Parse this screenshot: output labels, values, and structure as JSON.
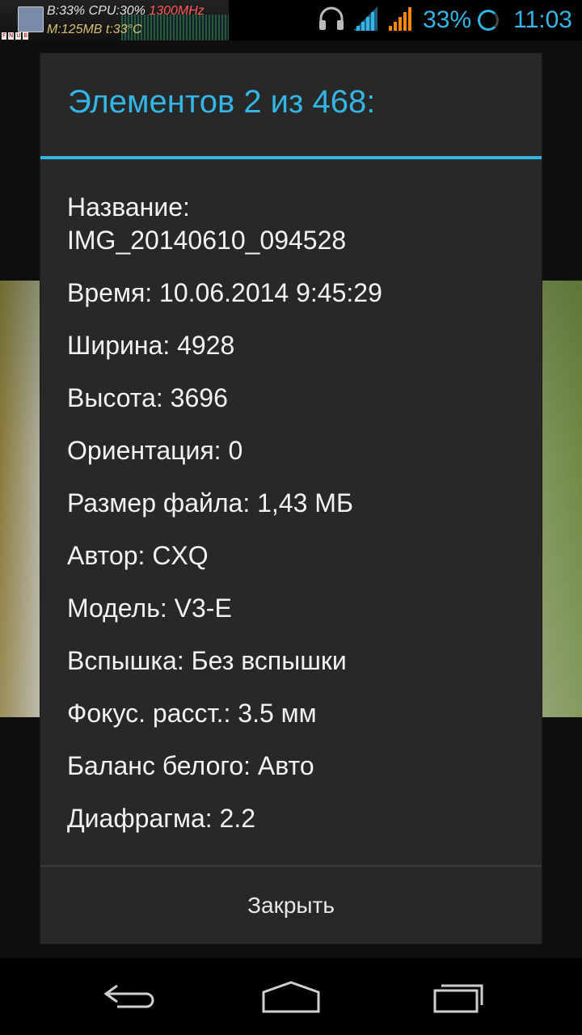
{
  "status_bar": {
    "monitor_line1_prefix": "B:33% CPU:30%",
    "monitor_freq": "1300MHz",
    "monitor_line2": "M:125MB t:33°C",
    "monitor_flags": [
      "F",
      "N",
      "U",
      "B"
    ],
    "battery_percent": "33%",
    "time": "11:03",
    "icons": [
      "headphones-icon",
      "wifi-signal-icon",
      "cell-signal-icon",
      "battery-icon"
    ],
    "accent_color": "#33b5e5",
    "signal_color": "#ff8800"
  },
  "dialog": {
    "title": "Элементов 2 из 468:",
    "properties": [
      {
        "label": "Название:",
        "value": "IMG_20140610_094528"
      },
      {
        "label": "Время:",
        "value": "10.06.2014 9:45:29"
      },
      {
        "label": "Ширина:",
        "value": "4928"
      },
      {
        "label": "Высота:",
        "value": "3696"
      },
      {
        "label": "Ориентация:",
        "value": "0"
      },
      {
        "label": "Размер файла:",
        "value": "1,43 МБ"
      },
      {
        "label": "Автор:",
        "value": "CXQ"
      },
      {
        "label": "Модель:",
        "value": "V3-E"
      },
      {
        "label": "Вспышка:",
        "value": "Без вспышки"
      },
      {
        "label": "Фокус. расст.:",
        "value": "3.5 мм"
      },
      {
        "label": "Баланс белого:",
        "value": "Авто"
      },
      {
        "label": "Диафрагма:",
        "value": "2.2"
      }
    ],
    "close_label": "Закрыть"
  },
  "navigation_bar": {
    "icons": [
      "back-icon",
      "home-icon",
      "recent-apps-icon"
    ]
  }
}
